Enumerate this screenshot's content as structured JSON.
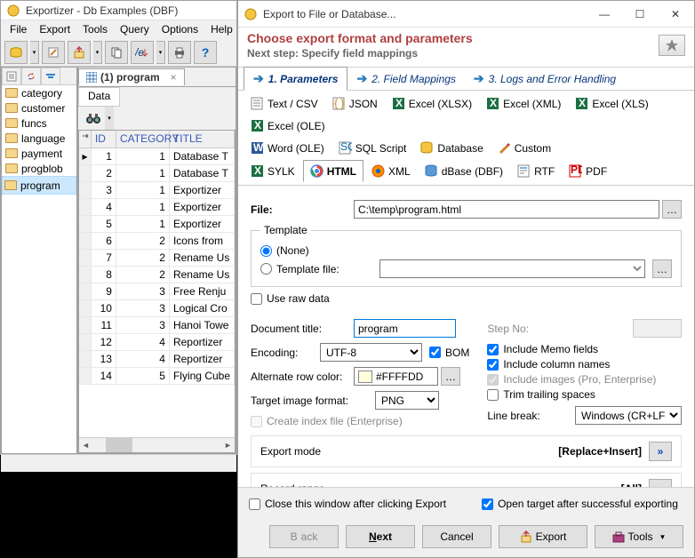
{
  "main_window": {
    "title": "Exportizer - Db Examples (DBF)",
    "menus": [
      "File",
      "Export",
      "Tools",
      "Query",
      "Options",
      "Help"
    ],
    "tree_items": [
      "category",
      "customer",
      "funcs",
      "language",
      "payment",
      "progblob",
      "program"
    ],
    "selected_tree_item": "program",
    "file_tab": "(1) program",
    "data_tab": "Data",
    "grid_headers": {
      "id": "ID",
      "category": "CATEGORY",
      "title": "TITLE"
    },
    "grid_rows": [
      {
        "id": "1",
        "cat": "1",
        "title": "Database T"
      },
      {
        "id": "2",
        "cat": "1",
        "title": "Database T"
      },
      {
        "id": "3",
        "cat": "1",
        "title": "Exportizer"
      },
      {
        "id": "4",
        "cat": "1",
        "title": "Exportizer"
      },
      {
        "id": "5",
        "cat": "1",
        "title": "Exportizer"
      },
      {
        "id": "6",
        "cat": "2",
        "title": "Icons from"
      },
      {
        "id": "7",
        "cat": "2",
        "title": "Rename Us"
      },
      {
        "id": "8",
        "cat": "2",
        "title": "Rename Us"
      },
      {
        "id": "9",
        "cat": "3",
        "title": "Free Renju"
      },
      {
        "id": "10",
        "cat": "3",
        "title": "Logical Cro"
      },
      {
        "id": "11",
        "cat": "3",
        "title": "Hanoi Towe"
      },
      {
        "id": "12",
        "cat": "4",
        "title": "Reportizer"
      },
      {
        "id": "13",
        "cat": "4",
        "title": "Reportizer"
      },
      {
        "id": "14",
        "cat": "5",
        "title": "Flying Cube"
      }
    ]
  },
  "export_dialog": {
    "title": "Export to File or Database...",
    "header": "Choose export format and parameters",
    "subheader": "Next step: Specify field mappings",
    "steps": [
      "1. Parameters",
      "2. Field Mappings",
      "3. Logs and Error Handling"
    ],
    "formats_row1": [
      "Text / CSV",
      "JSON",
      "Excel (XLSX)",
      "Excel (XML)",
      "Excel (XLS)",
      "Excel (OLE)"
    ],
    "formats_row2": [
      "Word (OLE)",
      "SQL Script",
      "Database",
      "Custom"
    ],
    "formats_row3": [
      "SYLK",
      "HTML",
      "XML",
      "dBase (DBF)",
      "RTF",
      "PDF"
    ],
    "file_label": "File:",
    "file_value": "C:\\temp\\program.html",
    "template_legend": "Template",
    "template_none": "(None)",
    "template_file": "Template file:",
    "use_raw_data": "Use raw data",
    "doc_title_label": "Document title:",
    "doc_title_value": "program",
    "step_no_label": "Step No:",
    "encoding_label": "Encoding:",
    "encoding_value": "UTF-8",
    "bom_label": "BOM",
    "include_memo": "Include Memo fields",
    "include_cols": "Include column names",
    "include_images": "Include images (Pro, Enterprise)",
    "trim_trailing": "Trim trailing spaces",
    "alt_row_label": "Alternate row color:",
    "alt_row_value": "#FFFFDD",
    "target_img_label": "Target image format:",
    "target_img_value": "PNG",
    "create_index": "Create index file (Enterprise)",
    "line_break_label": "Line break:",
    "line_break_value": "Windows (CR+LF)",
    "export_mode_label": "Export mode",
    "export_mode_value": "[Replace+Insert]",
    "record_range_label": "Record range",
    "record_range_value": "[All]",
    "close_after": "Close this window after clicking Export",
    "open_after": "Open target after successful exporting",
    "btn_back": "Back",
    "btn_next": "Next",
    "btn_cancel": "Cancel",
    "btn_export": "Export",
    "btn_tools": "Tools"
  }
}
